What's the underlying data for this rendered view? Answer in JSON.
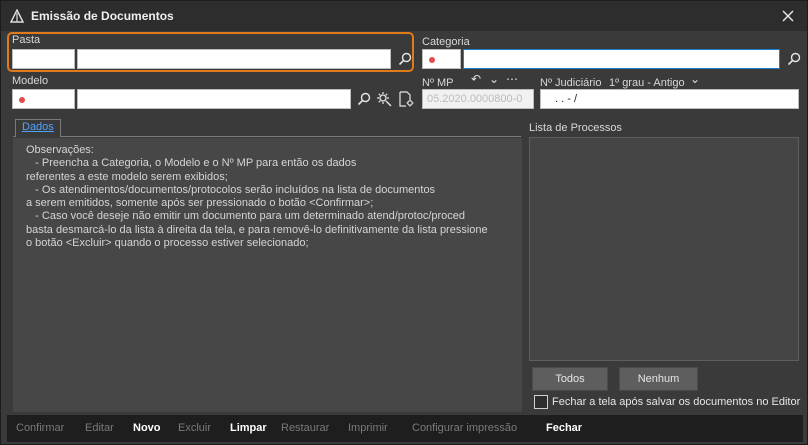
{
  "window": {
    "title": "Emissão de Documentos"
  },
  "fields": {
    "pasta": {
      "label": "Pasta"
    },
    "categoria": {
      "label": "Categoria"
    },
    "modelo": {
      "label": "Modelo"
    },
    "nmp": {
      "label": "Nº MP",
      "value": "05.2020.0000800-0"
    },
    "judiciario": {
      "label": "Nº Judiciário",
      "value": ". .    - /",
      "grau_option": "1º grau - Antigo"
    }
  },
  "tabs": [
    {
      "label": "Dados",
      "active": true
    }
  ],
  "observacoes": {
    "lines": [
      "Observações:",
      "   - Preencha a Categoria, o Modelo e o Nº MP para então os dados",
      "referentes a este modelo serem exibidos;",
      "   - Os atendimentos/documentos/protocolos serão incluídos na lista de documentos",
      "a serem emitidos, somente após ser pressionado o botão <Confirmar>;",
      "   - Caso você deseje não emitir um documento para um determinado atend/protoc/proced",
      "basta desmarcá-lo da lista à direita da tela, e para removê-lo definitivamente da lista pressione",
      "o botão <Excluir> quando o processo estiver selecionado;"
    ]
  },
  "lista": {
    "label": "Lista de Processos"
  },
  "buttons": {
    "todos": "Todos",
    "nenhum": "Nenhum"
  },
  "checkbox": {
    "label": "Fechar a tela após salvar os documentos no Editor",
    "checked": false
  },
  "footer": [
    {
      "label": "Confirmar",
      "enabled": false
    },
    {
      "label": "Editar",
      "enabled": false
    },
    {
      "label": "Novo",
      "enabled": true
    },
    {
      "label": "Excluir",
      "enabled": false
    },
    {
      "label": "Limpar",
      "enabled": true
    },
    {
      "label": "Restaurar",
      "enabled": false
    },
    {
      "label": "Imprimir",
      "enabled": false
    },
    {
      "label": "Configurar impressão",
      "enabled": false
    },
    {
      "label": "Fechar",
      "enabled": true
    }
  ],
  "colors": {
    "accent": "#1b7fd4",
    "highlight": "#e07b1a",
    "required_dot": "#e34b4b",
    "link_tab": "#4fa3ff"
  },
  "icons": [
    "app-logo-icon",
    "close-icon",
    "search-icon",
    "gear-icon",
    "undo-icon",
    "chevron-down-icon",
    "ellipsis-icon"
  ]
}
